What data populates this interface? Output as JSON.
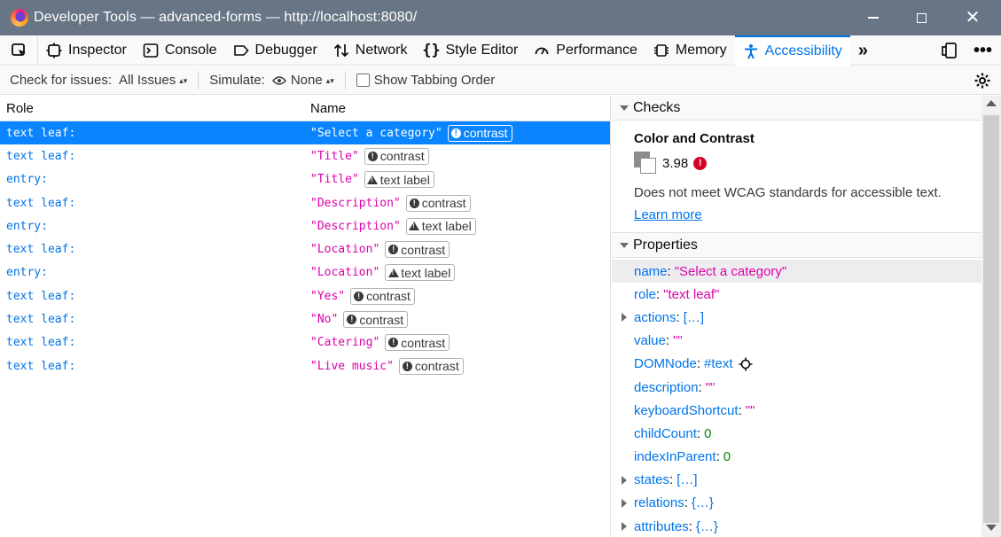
{
  "window": {
    "title": "Developer Tools — advanced-forms — http://localhost:8080/"
  },
  "tabs": [
    {
      "label": "Inspector",
      "icon": "inspector-icon"
    },
    {
      "label": "Console",
      "icon": "console-icon"
    },
    {
      "label": "Debugger",
      "icon": "debugger-icon"
    },
    {
      "label": "Network",
      "icon": "network-icon"
    },
    {
      "label": "Style Editor",
      "icon": "style-editor-icon"
    },
    {
      "label": "Performance",
      "icon": "performance-icon"
    },
    {
      "label": "Memory",
      "icon": "memory-icon"
    },
    {
      "label": "Accessibility",
      "icon": "accessibility-icon",
      "selected": true
    }
  ],
  "toolbar": {
    "check_label": "Check for issues:",
    "check_value": "All Issues",
    "simulate_label": "Simulate:",
    "simulate_value": "None",
    "tabbing_label": "Show Tabbing Order"
  },
  "tree": {
    "col_role": "Role",
    "col_name": "Name",
    "rows": [
      {
        "role": "text leaf:",
        "name": "\"Select a category\"",
        "badge": "contrast",
        "badge_type": "error",
        "selected": true
      },
      {
        "role": "text leaf:",
        "name": "\"Title\"",
        "badge": "contrast",
        "badge_type": "error"
      },
      {
        "role": "entry:",
        "name": "\"Title\"",
        "badge": "text label",
        "badge_type": "warning"
      },
      {
        "role": "text leaf:",
        "name": "\"Description\"",
        "badge": "contrast",
        "badge_type": "error"
      },
      {
        "role": "entry:",
        "name": "\"Description\"",
        "badge": "text label",
        "badge_type": "warning"
      },
      {
        "role": "text leaf:",
        "name": "\"Location\"",
        "badge": "contrast",
        "badge_type": "error"
      },
      {
        "role": "entry:",
        "name": "\"Location\"",
        "badge": "text label",
        "badge_type": "warning"
      },
      {
        "role": "text leaf:",
        "name": "\"Yes\"",
        "badge": "contrast",
        "badge_type": "error"
      },
      {
        "role": "text leaf:",
        "name": "\"No\"",
        "badge": "contrast",
        "badge_type": "error"
      },
      {
        "role": "text leaf:",
        "name": "\"Catering\"",
        "badge": "contrast",
        "badge_type": "error"
      },
      {
        "role": "text leaf:",
        "name": "\"Live music\"",
        "badge": "contrast",
        "badge_type": "error"
      }
    ]
  },
  "checks": {
    "header": "Checks",
    "title": "Color and Contrast",
    "ratio": "3.98",
    "message": "Does not meet WCAG standards for accessible text.",
    "link": "Learn more",
    "colors": {
      "foreground": "#8c8c8c",
      "background": "#ffffff",
      "error": "#d70022"
    }
  },
  "properties": {
    "header": "Properties",
    "items": [
      {
        "key": "name",
        "value": "\"Select a category\"",
        "type": "string",
        "selected": true
      },
      {
        "key": "role",
        "value": "\"text leaf\"",
        "type": "string"
      },
      {
        "key": "actions",
        "value": "[…]",
        "type": "object",
        "expandable": true
      },
      {
        "key": "value",
        "value": "\"\"",
        "type": "string"
      },
      {
        "key": "DOMNode",
        "value": "#text",
        "type": "object",
        "target": true
      },
      {
        "key": "description",
        "value": "\"\"",
        "type": "string"
      },
      {
        "key": "keyboardShortcut",
        "value": "\"\"",
        "type": "string"
      },
      {
        "key": "childCount",
        "value": "0",
        "type": "number"
      },
      {
        "key": "indexInParent",
        "value": "0",
        "type": "number"
      },
      {
        "key": "states",
        "value": "[…]",
        "type": "object",
        "expandable": true
      },
      {
        "key": "relations",
        "value": "{…}",
        "type": "object",
        "expandable": true
      },
      {
        "key": "attributes",
        "value": "{…}",
        "type": "object",
        "expandable": true
      }
    ]
  },
  "accent_color": "#0074e8"
}
